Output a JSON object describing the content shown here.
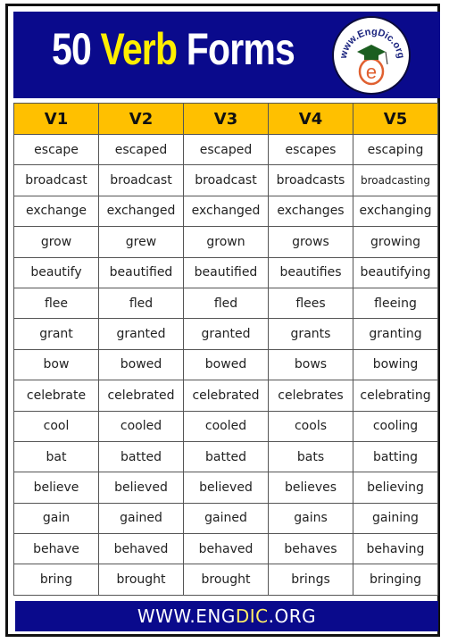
{
  "header": {
    "title_count": "50",
    "title_word1": "Verb",
    "title_word2": "Forms",
    "logo_text": "www.EngDic.org",
    "logo_letter": "e"
  },
  "table": {
    "columns": [
      "V1",
      "V2",
      "V3",
      "V4",
      "V5"
    ],
    "rows": [
      [
        "escape",
        "escaped",
        "escaped",
        "escapes",
        "escaping"
      ],
      [
        "broadcast",
        "broadcast",
        "broadcast",
        "broadcasts",
        "broadcasting"
      ],
      [
        "exchange",
        "exchanged",
        "exchanged",
        "exchanges",
        "exchanging"
      ],
      [
        "grow",
        "grew",
        "grown",
        "grows",
        "growing"
      ],
      [
        "beautify",
        "beautified",
        "beautified",
        "beautifies",
        "beautifying"
      ],
      [
        "flee",
        "fled",
        "fled",
        "flees",
        "fleeing"
      ],
      [
        "grant",
        "granted",
        "granted",
        "grants",
        "granting"
      ],
      [
        "bow",
        "bowed",
        "bowed",
        "bows",
        "bowing"
      ],
      [
        "celebrate",
        "celebrated",
        "celebrated",
        "celebrates",
        "celebrating"
      ],
      [
        "cool",
        "cooled",
        "cooled",
        "cools",
        "cooling"
      ],
      [
        "bat",
        "batted",
        "batted",
        "bats",
        "batting"
      ],
      [
        "believe",
        "believed",
        "believed",
        "believes",
        "believing"
      ],
      [
        "gain",
        "gained",
        "gained",
        "gains",
        "gaining"
      ],
      [
        "behave",
        "behaved",
        "behaved",
        "behaves",
        "behaving"
      ],
      [
        "bring",
        "brought",
        "brought",
        "brings",
        "bringing"
      ]
    ]
  },
  "footer": {
    "prefix": "WWW.ENG",
    "highlight": "DIC",
    "suffix": ".ORG"
  },
  "colors": {
    "banner": "#0a0a8c",
    "header_row": "#ffc000",
    "highlight": "#ffee00"
  }
}
